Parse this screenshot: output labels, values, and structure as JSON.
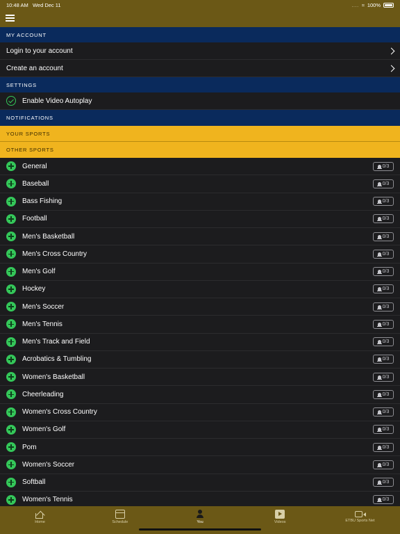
{
  "status_bar": {
    "time": "10:48 AM",
    "date": "Wed Dec 11",
    "signal": "....",
    "battery": "100%"
  },
  "sections": {
    "my_account": "MY ACCOUNT",
    "settings": "SETTINGS",
    "notifications": "NOTIFICATIONS",
    "your_sports": "YOUR SPORTS",
    "other_sports": "OTHER SPORTS"
  },
  "account": {
    "login": "Login to your account",
    "create": "Create an account"
  },
  "settings": {
    "autoplay": "Enable Video Autoplay"
  },
  "sports": [
    {
      "name": "General",
      "count": "0/3"
    },
    {
      "name": "Baseball",
      "count": "0/3"
    },
    {
      "name": "Bass Fishing",
      "count": "0/3"
    },
    {
      "name": "Football",
      "count": "0/3"
    },
    {
      "name": "Men's Basketball",
      "count": "0/3"
    },
    {
      "name": "Men's Cross Country",
      "count": "0/3"
    },
    {
      "name": "Men's Golf",
      "count": "0/3"
    },
    {
      "name": "Hockey",
      "count": "0/3"
    },
    {
      "name": "Men's Soccer",
      "count": "0/3"
    },
    {
      "name": "Men's Tennis",
      "count": "0/3"
    },
    {
      "name": "Men's Track and Field",
      "count": "0/3"
    },
    {
      "name": "Acrobatics & Tumbling",
      "count": "0/3"
    },
    {
      "name": "Women's Basketball",
      "count": "0/3"
    },
    {
      "name": "Cheerleading",
      "count": "0/3"
    },
    {
      "name": "Women's Cross Country",
      "count": "0/3"
    },
    {
      "name": "Women's Golf",
      "count": "0/3"
    },
    {
      "name": "Pom",
      "count": "0/3"
    },
    {
      "name": "Women's Soccer",
      "count": "0/3"
    },
    {
      "name": "Softball",
      "count": "0/3"
    },
    {
      "name": "Women's Tennis",
      "count": "0/3"
    }
  ],
  "tabs": [
    {
      "label": "Home",
      "icon": "home-icon"
    },
    {
      "label": "Schedule",
      "icon": "calendar-icon"
    },
    {
      "label": "You",
      "icon": "person-icon"
    },
    {
      "label": "Videos",
      "icon": "play-icon"
    },
    {
      "label": "ETBU Sports Net",
      "icon": "video-camera-icon"
    }
  ],
  "colors": {
    "bar_gold": "#6b5816",
    "section_blue": "#0a2a5c",
    "section_gold": "#f0b41e",
    "accent_green": "#34c759"
  }
}
